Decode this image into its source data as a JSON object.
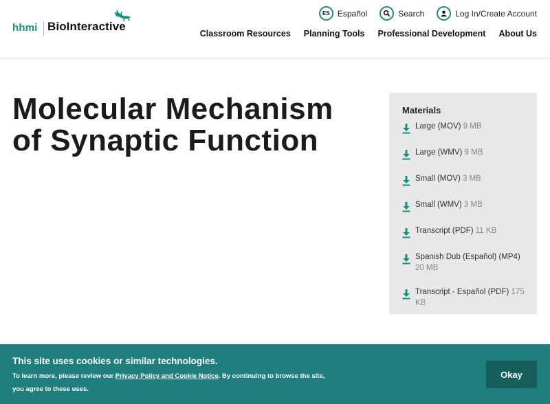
{
  "header": {
    "logo_hhmi": "hhmi",
    "logo_name": "BioInteractive",
    "utility": {
      "espanol_badge": "ES",
      "espanol_label": "Español",
      "search_label": "Search",
      "login_label": "Log In/Create Account"
    },
    "nav": [
      {
        "label": "Classroom Resources"
      },
      {
        "label": "Planning Tools"
      },
      {
        "label": "Professional Development"
      },
      {
        "label": "About Us"
      }
    ]
  },
  "main": {
    "title": "Molecular Mechanism of Synaptic Function"
  },
  "materials": {
    "heading": "Materials",
    "items": [
      {
        "name": "Large (MOV)",
        "size": "9 MB"
      },
      {
        "name": "Large (WMV)",
        "size": "9 MB"
      },
      {
        "name": "Small (MOV)",
        "size": "3 MB"
      },
      {
        "name": "Small (WMV)",
        "size": "3 MB"
      },
      {
        "name": "Transcript (PDF)",
        "size": "11 KB"
      },
      {
        "name": "Spanish Dub (Español) (MP4)",
        "size": "20 MB"
      },
      {
        "name": "Transcript - Español (PDF)",
        "size": "175 KB"
      }
    ]
  },
  "cookie": {
    "heading": "This site uses cookies or similar technologies.",
    "text_before": "To learn more, please review our ",
    "link": "Privacy Policy and Cookie Notice",
    "text_after": ". By continuing to browse the site, you agree to these uses.",
    "button": "Okay"
  },
  "colors": {
    "brand_teal": "#1c8c7c",
    "banner": "#1e7f7d",
    "banner_button": "#155e5c",
    "materials_bg": "#e8e8e8"
  },
  "icons": {
    "espanol": "es-badge-icon",
    "search": "search-icon",
    "login": "user-icon",
    "download": "download-icon",
    "logo_mark": "lizard-logo-icon"
  }
}
